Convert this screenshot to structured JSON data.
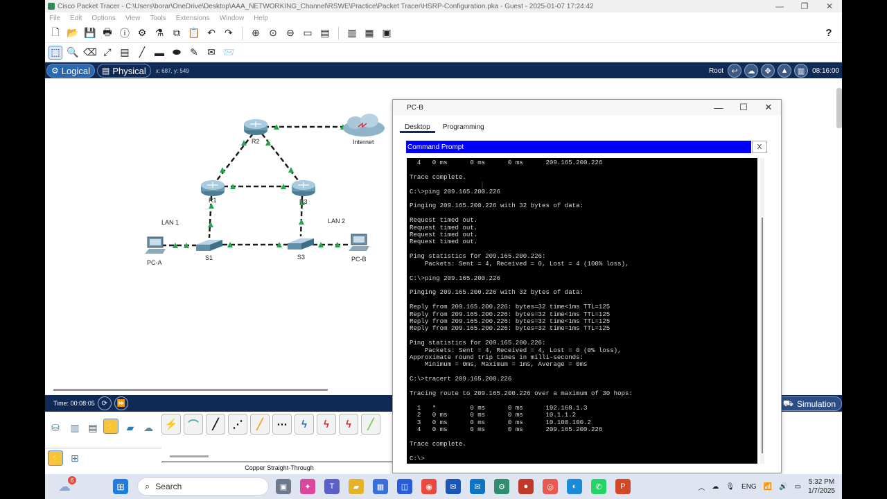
{
  "app": {
    "title": "Cisco Packet Tracer - C:\\Users\\borar\\OneDrive\\Desktop\\AAA_NETWORKING_Channel\\RSWE\\Practice\\Packet Tracer\\HSRP-Configuration.pka - Guest - 2025-01-07 17:24:42",
    "window_controls": [
      "—",
      "❐",
      "✕"
    ]
  },
  "menu": [
    "File",
    "Edit",
    "Options",
    "View",
    "Tools",
    "Extensions",
    "Window",
    "Help"
  ],
  "modebar": {
    "logical": "Logical",
    "physical": "Physical",
    "coords": "x: 687, y: 549",
    "root": "Root",
    "clock": "08:16:00"
  },
  "topology": {
    "devices": [
      "R2",
      "Internet",
      "R1",
      "R3",
      "S1",
      "S3",
      "PC-A",
      "PC-B"
    ],
    "labels": [
      "LAN 1",
      "LAN 2"
    ],
    "link_color": "#1a1a1a",
    "up_color": "#22a84b"
  },
  "bottombar": {
    "time": "Time: 00:08:05",
    "simulation": "Simulation"
  },
  "device_panel": {
    "cable_label": "Copper Straight-Through"
  },
  "pcb_window": {
    "title": "PC-B",
    "tabs": [
      "Desktop",
      "Programming"
    ],
    "cmd_title": "Command Prompt",
    "cmd_close": "X",
    "terminal_lines": [
      "  4   0 ms      0 ms      0 ms      209.165.200.226",
      "",
      "Trace complete.",
      "",
      "C:\\>ping 209.165.200.226",
      "",
      "Pinging 209.165.200.226 with 32 bytes of data:",
      "",
      "Request timed out.",
      "Request timed out.",
      "Request timed out.",
      "Request timed out.",
      "",
      "Ping statistics for 209.165.200.226:",
      "    Packets: Sent = 4, Received = 0, Lost = 4 (100% loss),",
      "",
      "C:\\>ping 209.165.200.226",
      "",
      "Pinging 209.165.200.226 with 32 bytes of data:",
      "",
      "Reply from 209.165.200.226: bytes=32 time<1ms TTL=125",
      "Reply from 209.165.200.226: bytes=32 time<1ms TTL=125",
      "Reply from 209.165.200.226: bytes=32 time<1ms TTL=125",
      "Reply from 209.165.200.226: bytes=32 time=1ms TTL=125",
      "",
      "Ping statistics for 209.165.200.226:",
      "    Packets: Sent = 4, Received = 4, Lost = 0 (0% loss),",
      "Approximate round trip times in milli-seconds:",
      "    Minimum = 0ms, Maximum = 1ms, Average = 0ms",
      "",
      "C:\\>tracert 209.165.200.226",
      "",
      "Tracing route to 209.165.200.226 over a maximum of 30 hops:",
      "",
      "  1   *         0 ms      0 ms      192.168.1.3",
      "  2   0 ms      0 ms      0 ms      10.1.1.2",
      "  3   0 ms      0 ms      0 ms      10.100.100.2",
      "  4   0 ms      0 ms      0 ms      209.165.200.226",
      "",
      "Trace complete.",
      "",
      "C:\\>"
    ]
  },
  "taskbar": {
    "search_placeholder": "Search",
    "notification_count": "6",
    "language": "ENG",
    "time": "5:32 PM",
    "date": "1/7/2025"
  }
}
